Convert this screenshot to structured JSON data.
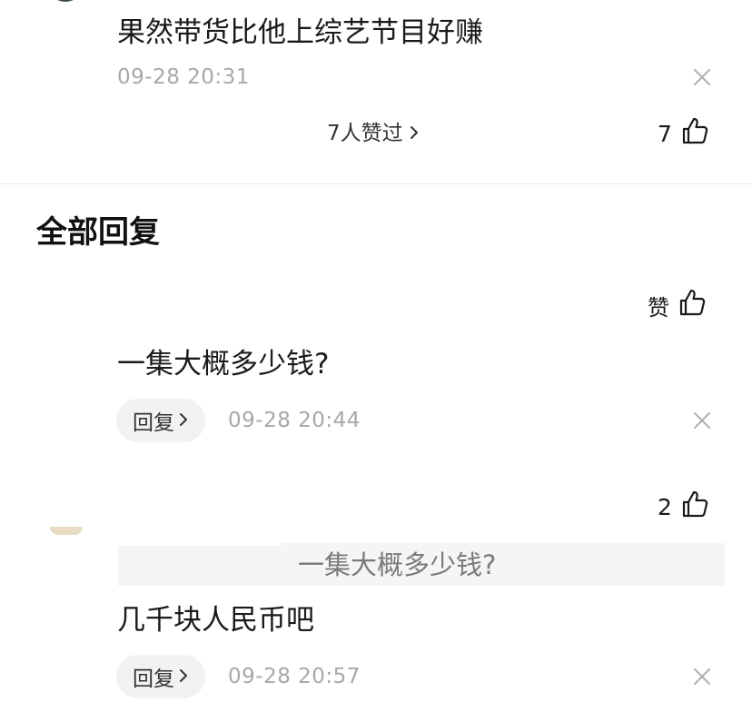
{
  "top_comment": {
    "text": "果然带货比他上综艺节目好赚",
    "time": "09-28 20:31",
    "liked_by": "7人赞过",
    "like_count": "7"
  },
  "section": {
    "title": "全部回复"
  },
  "replies": [
    {
      "like_label": "赞",
      "text": "一集大概多少钱?",
      "reply_label": "回复",
      "time": "09-28 20:44"
    },
    {
      "like_label": "2",
      "quote": "一集大概多少钱?",
      "text": "几千块人民币吧",
      "reply_label": "回复",
      "time": "09-28 20:57"
    }
  ],
  "icons": {
    "thumb": "thumbs-up-icon",
    "close": "close-icon",
    "chevron": "chevron-right-icon"
  }
}
